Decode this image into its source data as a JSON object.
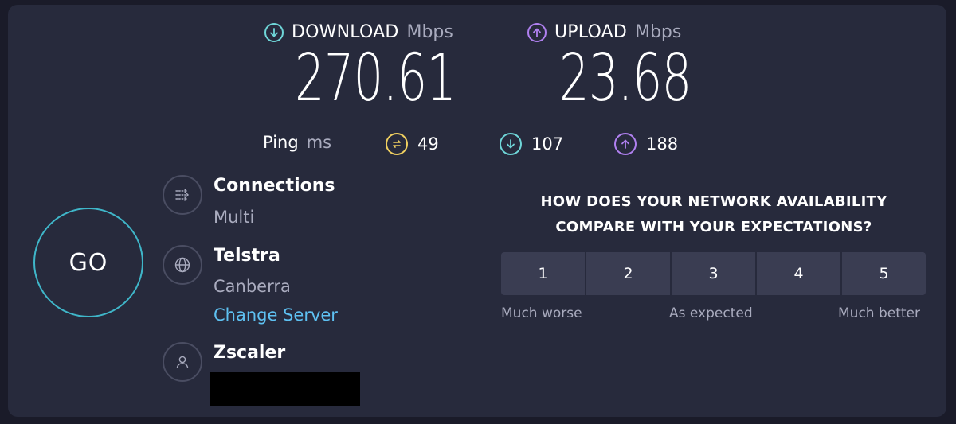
{
  "download": {
    "label": "DOWNLOAD",
    "unit": "Mbps",
    "value": "270.61",
    "icon": "download-arrow-icon",
    "color": "#6fd6d8"
  },
  "upload": {
    "label": "UPLOAD",
    "unit": "Mbps",
    "value": "23.68",
    "icon": "upload-arrow-icon",
    "color": "#b080f0"
  },
  "ping": {
    "label": "Ping",
    "unit": "ms",
    "idle": {
      "value": "49",
      "icon": "ping-jitter-icon",
      "color": "#f0d060"
    },
    "download": {
      "value": "107",
      "icon": "download-arrow-icon",
      "color": "#6fd6d8"
    },
    "upload": {
      "value": "188",
      "icon": "upload-arrow-icon",
      "color": "#b080f0"
    }
  },
  "go_button": {
    "label": "GO",
    "color": "#3fb6c9"
  },
  "connections": {
    "title": "Connections",
    "value": "Multi",
    "icon": "connections-icon"
  },
  "server": {
    "title": "Telstra",
    "location": "Canberra",
    "change_label": "Change Server",
    "icon": "globe-icon",
    "link_color": "#5ec1f2"
  },
  "provider": {
    "title": "Zscaler",
    "icon": "user-icon"
  },
  "survey": {
    "question_line1": "HOW DOES YOUR NETWORK AVAILABILITY",
    "question_line2": "COMPARE WITH YOUR EXPECTATIONS?",
    "options": [
      "1",
      "2",
      "3",
      "4",
      "5"
    ],
    "label_low": "Much worse",
    "label_mid": "As expected",
    "label_high": "Much better"
  }
}
